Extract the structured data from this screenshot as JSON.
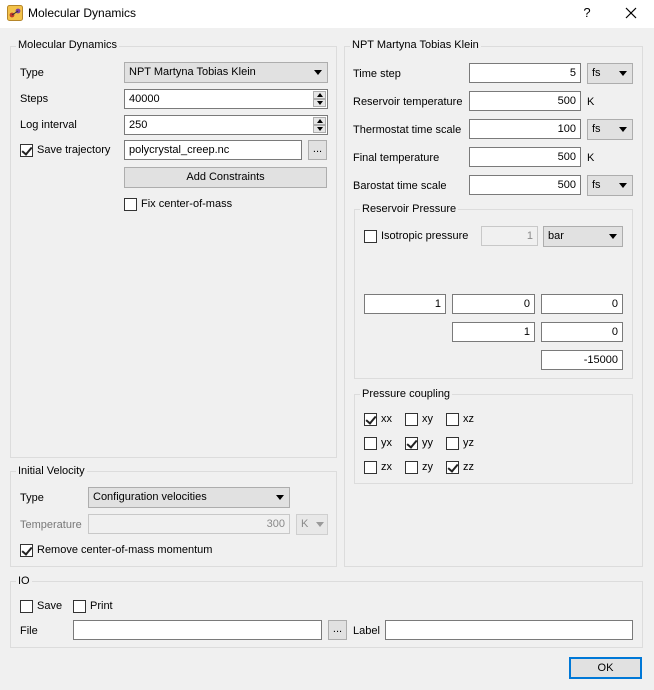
{
  "window": {
    "title": "Molecular Dynamics",
    "help": "?",
    "close": "✕"
  },
  "md": {
    "group_title": "Molecular Dynamics",
    "type_label": "Type",
    "type_value": "NPT Martyna Tobias Klein",
    "steps_label": "Steps",
    "steps_value": "40000",
    "log_label": "Log interval",
    "log_value": "250",
    "save_traj_label": "Save trajectory",
    "save_traj_checked": true,
    "traj_file": "polycrystal_creep.nc",
    "browse": "...",
    "add_constraints": "Add Constraints",
    "fix_com_label": "Fix center-of-mass",
    "fix_com_checked": false
  },
  "velocity": {
    "group_title": "Initial Velocity",
    "type_label": "Type",
    "type_value": "Configuration velocities",
    "temp_label": "Temperature",
    "temp_value": "300",
    "temp_unit": "K",
    "remove_com_label": "Remove center-of-mass momentum",
    "remove_com_checked": true
  },
  "npt": {
    "group_title": "NPT Martyna Tobias Klein",
    "time_step_label": "Time step",
    "time_step_value": "5",
    "time_step_unit": "fs",
    "res_temp_label": "Reservoir temperature",
    "res_temp_value": "500",
    "res_temp_unit": "K",
    "thermo_label": "Thermostat time scale",
    "thermo_value": "100",
    "thermo_unit": "fs",
    "final_temp_label": "Final temperature",
    "final_temp_value": "500",
    "final_temp_unit": "K",
    "baro_label": "Barostat time scale",
    "baro_value": "500",
    "baro_unit": "fs"
  },
  "pressure": {
    "group_title": "Reservoir Pressure",
    "isotropic_label": "Isotropic pressure",
    "isotropic_checked": false,
    "isotropic_value": "1",
    "unit": "bar",
    "matrix": {
      "xx": "1",
      "xy": "0",
      "xz": "0",
      "yy": "1",
      "yz": "0",
      "zz": "-15000"
    }
  },
  "coupling": {
    "group_title": "Pressure coupling",
    "xx": "xx",
    "xy": "xy",
    "xz": "xz",
    "yx": "yx",
    "yy": "yy",
    "yz": "yz",
    "zx": "zx",
    "zy": "zy",
    "zz": "zz"
  },
  "io": {
    "group_title": "IO",
    "save_label": "Save",
    "print_label": "Print",
    "file_label": "File",
    "file_value": "",
    "browse": "...",
    "label_label": "Label",
    "label_value": ""
  },
  "footer": {
    "ok": "OK"
  },
  "colors": {
    "accent": "#0078d7",
    "background": "#f0f0f0"
  }
}
